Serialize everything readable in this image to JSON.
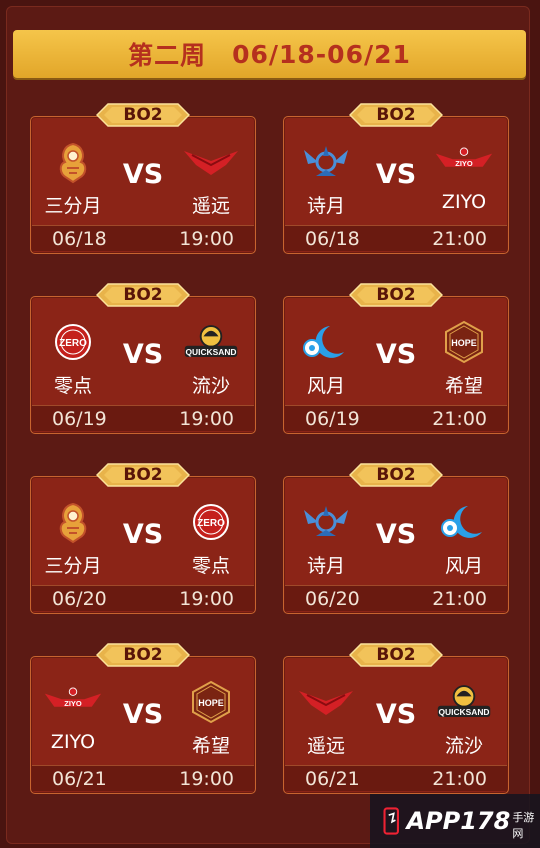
{
  "header": {
    "week": "第二周",
    "dates": "06/18-06/21"
  },
  "matches": [
    {
      "format": "BO2",
      "vs": "VS",
      "team_a": "三分月",
      "logo_a": "sanfenyue-logo",
      "team_b": "遥远",
      "logo_b": "yaoyuan-logo",
      "date": "06/18",
      "time": "19:00"
    },
    {
      "format": "BO2",
      "vs": "VS",
      "team_a": "诗月",
      "logo_a": "shiyue-logo",
      "team_b": "ZIYO",
      "logo_b": "ziyo-logo",
      "date": "06/18",
      "time": "21:00"
    },
    {
      "format": "BO2",
      "vs": "VS",
      "team_a": "零点",
      "logo_a": "zero-logo",
      "team_b": "流沙",
      "logo_b": "quicksand-logo",
      "date": "06/19",
      "time": "19:00"
    },
    {
      "format": "BO2",
      "vs": "VS",
      "team_a": "风月",
      "logo_a": "fengyue-logo",
      "team_b": "希望",
      "logo_b": "hope-logo",
      "date": "06/19",
      "time": "21:00"
    },
    {
      "format": "BO2",
      "vs": "VS",
      "team_a": "三分月",
      "logo_a": "sanfenyue-logo",
      "team_b": "零点",
      "logo_b": "zero-logo",
      "date": "06/20",
      "time": "19:00"
    },
    {
      "format": "BO2",
      "vs": "VS",
      "team_a": "诗月",
      "logo_a": "shiyue-logo",
      "team_b": "风月",
      "logo_b": "fengyue-logo",
      "date": "06/20",
      "time": "21:00"
    },
    {
      "format": "BO2",
      "vs": "VS",
      "team_a": "ZIYO",
      "logo_a": "ziyo-logo",
      "team_b": "希望",
      "logo_b": "hope-logo",
      "date": "06/21",
      "time": "19:00"
    },
    {
      "format": "BO2",
      "vs": "VS",
      "team_a": "遥远",
      "logo_a": "yaoyuan-logo",
      "team_b": "流沙",
      "logo_b": "quicksand-logo",
      "date": "06/21",
      "time": "21:00"
    }
  ],
  "logo_text": {
    "zero": "ZERO",
    "quicksand": "QUICKSAND",
    "hope": "HOPE",
    "ziyo": "ZIYO"
  },
  "watermark": {
    "brand": "APP178",
    "suffix": "手游网"
  },
  "colors": {
    "background": "#4a1410",
    "card": "#8b2417",
    "header": "#f2b83a",
    "badge": "#e8b34a",
    "title_text": "#b5301e"
  }
}
